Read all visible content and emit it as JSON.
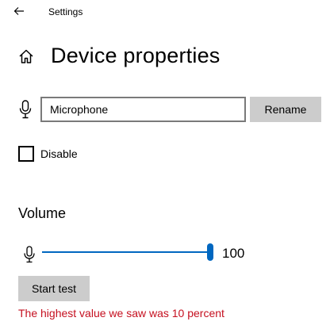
{
  "window": {
    "title": "Settings",
    "back_icon": "back-arrow-icon"
  },
  "header": {
    "title": "Device properties",
    "home_icon": "home-icon"
  },
  "device_name": {
    "value": "Microphone",
    "icon": "microphone-icon",
    "rename_label": "Rename"
  },
  "disable": {
    "label": "Disable",
    "checked": false
  },
  "volume": {
    "title": "Volume",
    "value": 100,
    "value_text": "100",
    "max": 100,
    "icon": "microphone-icon",
    "accent_color": "#0067c0"
  },
  "test": {
    "button_label": "Start test",
    "status_text": "The highest value we saw was 10 percent",
    "status_color": "#c50f1f"
  }
}
